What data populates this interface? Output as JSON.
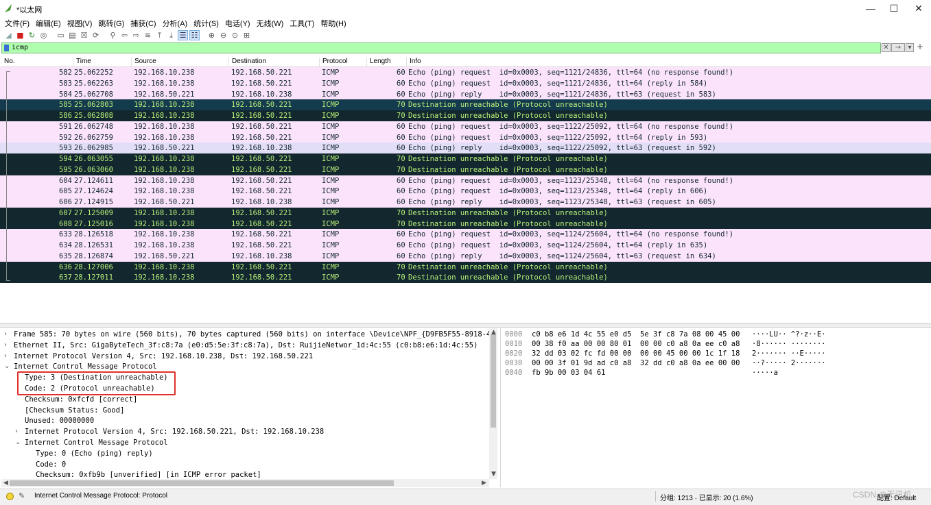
{
  "window": {
    "title": "*以太网",
    "minimize": "—",
    "maximize": "☐",
    "close": "✕"
  },
  "menu": [
    "文件(F)",
    "编辑(E)",
    "视图(V)",
    "跳转(G)",
    "捕获(C)",
    "分析(A)",
    "统计(S)",
    "电话(Y)",
    "无线(W)",
    "工具(T)",
    "帮助(H)"
  ],
  "toolbar": {
    "icons": [
      "shark-fin-start-icon",
      "stop-icon",
      "restart-icon",
      "options-icon",
      "open-file-icon",
      "save-icon",
      "close-file-icon",
      "reload-icon",
      "find-icon",
      "go-back-icon",
      "go-forward-icon",
      "go-to-packet-icon",
      "first-packet-icon",
      "last-packet-icon",
      "auto-scroll-icon",
      "colorize-icon",
      "zoom-in-icon",
      "zoom-out-icon",
      "normal-size-icon",
      "resize-columns-icon"
    ]
  },
  "filter": {
    "value": "icmp",
    "clear_label": "✕",
    "apply_label": "→",
    "dropdown_label": "▾",
    "add_label": "+"
  },
  "columns": [
    "No.",
    "Time",
    "Source",
    "Destination",
    "Protocol",
    "Length",
    "Info"
  ],
  "packets": [
    {
      "no": "582",
      "time": "25.062252",
      "src": "192.168.10.238",
      "dst": "192.168.50.221",
      "proto": "ICMP",
      "len": "60",
      "info": "Echo (ping) request  id=0x0003, seq=1121/24836, ttl=64 (no response found!)",
      "style": "echo"
    },
    {
      "no": "583",
      "time": "25.062263",
      "src": "192.168.10.238",
      "dst": "192.168.50.221",
      "proto": "ICMP",
      "len": "60",
      "info": "Echo (ping) request  id=0x0003, seq=1121/24836, ttl=64 (reply in 584)",
      "style": "echo"
    },
    {
      "no": "584",
      "time": "25.062708",
      "src": "192.168.50.221",
      "dst": "192.168.10.238",
      "proto": "ICMP",
      "len": "60",
      "info": "Echo (ping) reply    id=0x0003, seq=1121/24836, ttl=63 (request in 583)",
      "style": "echo"
    },
    {
      "no": "585",
      "time": "25.062803",
      "src": "192.168.10.238",
      "dst": "192.168.50.221",
      "proto": "ICMP",
      "len": "70",
      "info": "Destination unreachable (Protocol unreachable)",
      "style": "selected"
    },
    {
      "no": "586",
      "time": "25.062808",
      "src": "192.168.10.238",
      "dst": "192.168.50.221",
      "proto": "ICMP",
      "len": "70",
      "info": "Destination unreachable (Protocol unreachable)",
      "style": "unreach"
    },
    {
      "no": "591",
      "time": "26.062748",
      "src": "192.168.10.238",
      "dst": "192.168.50.221",
      "proto": "ICMP",
      "len": "60",
      "info": "Echo (ping) request  id=0x0003, seq=1122/25092, ttl=64 (no response found!)",
      "style": "echo"
    },
    {
      "no": "592",
      "time": "26.062759",
      "src": "192.168.10.238",
      "dst": "192.168.50.221",
      "proto": "ICMP",
      "len": "60",
      "info": "Echo (ping) request  id=0x0003, seq=1122/25092, ttl=64 (reply in 593)",
      "style": "echo"
    },
    {
      "no": "593",
      "time": "26.062985",
      "src": "192.168.50.221",
      "dst": "192.168.10.238",
      "proto": "ICMP",
      "len": "60",
      "info": "Echo (ping) reply    id=0x0003, seq=1122/25092, ttl=63 (request in 592)",
      "style": "selecho"
    },
    {
      "no": "594",
      "time": "26.063055",
      "src": "192.168.10.238",
      "dst": "192.168.50.221",
      "proto": "ICMP",
      "len": "70",
      "info": "Destination unreachable (Protocol unreachable)",
      "style": "unreach"
    },
    {
      "no": "595",
      "time": "26.063060",
      "src": "192.168.10.238",
      "dst": "192.168.50.221",
      "proto": "ICMP",
      "len": "70",
      "info": "Destination unreachable (Protocol unreachable)",
      "style": "unreach"
    },
    {
      "no": "604",
      "time": "27.124611",
      "src": "192.168.10.238",
      "dst": "192.168.50.221",
      "proto": "ICMP",
      "len": "60",
      "info": "Echo (ping) request  id=0x0003, seq=1123/25348, ttl=64 (no response found!)",
      "style": "echo"
    },
    {
      "no": "605",
      "time": "27.124624",
      "src": "192.168.10.238",
      "dst": "192.168.50.221",
      "proto": "ICMP",
      "len": "60",
      "info": "Echo (ping) request  id=0x0003, seq=1123/25348, ttl=64 (reply in 606)",
      "style": "echo"
    },
    {
      "no": "606",
      "time": "27.124915",
      "src": "192.168.50.221",
      "dst": "192.168.10.238",
      "proto": "ICMP",
      "len": "60",
      "info": "Echo (ping) reply    id=0x0003, seq=1123/25348, ttl=63 (request in 605)",
      "style": "echo"
    },
    {
      "no": "607",
      "time": "27.125009",
      "src": "192.168.10.238",
      "dst": "192.168.50.221",
      "proto": "ICMP",
      "len": "70",
      "info": "Destination unreachable (Protocol unreachable)",
      "style": "unreach"
    },
    {
      "no": "608",
      "time": "27.125016",
      "src": "192.168.10.238",
      "dst": "192.168.50.221",
      "proto": "ICMP",
      "len": "70",
      "info": "Destination unreachable (Protocol unreachable)",
      "style": "unreach"
    },
    {
      "no": "633",
      "time": "28.126518",
      "src": "192.168.10.238",
      "dst": "192.168.50.221",
      "proto": "ICMP",
      "len": "60",
      "info": "Echo (ping) request  id=0x0003, seq=1124/25604, ttl=64 (no response found!)",
      "style": "echo"
    },
    {
      "no": "634",
      "time": "28.126531",
      "src": "192.168.10.238",
      "dst": "192.168.50.221",
      "proto": "ICMP",
      "len": "60",
      "info": "Echo (ping) request  id=0x0003, seq=1124/25604, ttl=64 (reply in 635)",
      "style": "echo"
    },
    {
      "no": "635",
      "time": "28.126874",
      "src": "192.168.50.221",
      "dst": "192.168.10.238",
      "proto": "ICMP",
      "len": "60",
      "info": "Echo (ping) reply    id=0x0003, seq=1124/25604, ttl=63 (request in 634)",
      "style": "echo"
    },
    {
      "no": "636",
      "time": "28.127006",
      "src": "192.168.10.238",
      "dst": "192.168.50.221",
      "proto": "ICMP",
      "len": "70",
      "info": "Destination unreachable (Protocol unreachable)",
      "style": "unreach"
    },
    {
      "no": "637",
      "time": "28.127011",
      "src": "192.168.10.238",
      "dst": "192.168.50.221",
      "proto": "ICMP",
      "len": "70",
      "info": "Destination unreachable (Protocol unreachable)",
      "style": "unreach"
    }
  ],
  "details": [
    {
      "level": 0,
      "arrow": "›",
      "text": "Frame 585: 70 bytes on wire (560 bits), 70 bytes captured (560 bits) on interface \\Device\\NPF_{D9FB5F55-8918-4"
    },
    {
      "level": 0,
      "arrow": "›",
      "text": "Ethernet II, Src: GigaByteTech_3f:c8:7a (e0:d5:5e:3f:c8:7a), Dst: RuijieNetwor_1d:4c:55 (c0:b8:e6:1d:4c:55)"
    },
    {
      "level": 0,
      "arrow": "›",
      "text": "Internet Protocol Version 4, Src: 192.168.10.238, Dst: 192.168.50.221"
    },
    {
      "level": 0,
      "arrow": "⌄",
      "text": "Internet Control Message Protocol"
    },
    {
      "level": 1,
      "arrow": "",
      "text": "Type: 3 (Destination unreachable)"
    },
    {
      "level": 1,
      "arrow": "",
      "text": "Code: 2 (Protocol unreachable)"
    },
    {
      "level": 1,
      "arrow": "",
      "text": "Checksum: 0xfcfd [correct]"
    },
    {
      "level": 1,
      "arrow": "",
      "text": "[Checksum Status: Good]"
    },
    {
      "level": 1,
      "arrow": "",
      "text": "Unused: 00000000"
    },
    {
      "level": 1,
      "arrow": "›",
      "text": "Internet Protocol Version 4, Src: 192.168.50.221, Dst: 192.168.10.238"
    },
    {
      "level": 1,
      "arrow": "⌄",
      "text": "Internet Control Message Protocol"
    },
    {
      "level": 2,
      "arrow": "",
      "text": "Type: 0 (Echo (ping) reply)"
    },
    {
      "level": 2,
      "arrow": "",
      "text": "Code: 0"
    },
    {
      "level": 2,
      "arrow": "",
      "text": "Checksum: 0xfb9b [unverified] [in ICMP error packet]"
    }
  ],
  "bytes": [
    {
      "offset": "0000",
      "hex": "c0 b8 e6 1d 4c 55 e0 d5  5e 3f c8 7a 08 00 45 00",
      "ascii": "····LU·· ^?·z··E·"
    },
    {
      "offset": "0010",
      "hex": "00 38 f0 aa 00 00 80 01  00 00 c0 a8 0a ee c0 a8",
      "ascii": "·8······ ········"
    },
    {
      "offset": "0020",
      "hex": "32 dd 03 02 fc fd 00 00  00 00 45 00 00 1c 1f 18",
      "ascii": "2······· ··E·····"
    },
    {
      "offset": "0030",
      "hex": "00 00 3f 01 9d ad c0 a8  32 dd c0 a8 0a ee 00 00",
      "ascii": "··?····· 2·······"
    },
    {
      "offset": "0040",
      "hex": "fb 9b 00 03 04 61",
      "ascii": "·····a"
    }
  ],
  "status": {
    "text": "Internet Control Message Protocol: Protocol",
    "stats": "分组: 1213 · 已显示: 20 (1.6%)",
    "profile": "配置: Default",
    "watermark": "CSDN @无讯机"
  },
  "colors": {
    "filter_bg": "#afffaf",
    "echo_bg": "#fbe3fb",
    "unreachable_bg": "#12272e",
    "unreachable_fg": "#b8f07a",
    "highlight_box": "#e0302a"
  }
}
